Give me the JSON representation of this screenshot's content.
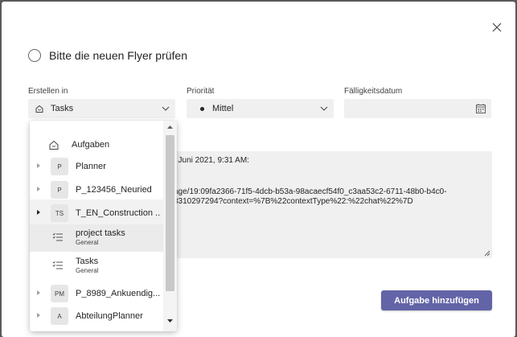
{
  "dialog": {
    "task_title": "Bitte die neuen Flyer prüfen"
  },
  "fields": {
    "create_in_label": "Erstellen in",
    "create_in_value": "Tasks",
    "priority_label": "Priorität",
    "priority_value": "Mittel",
    "due_date_label": "Fälligkeitsdatum",
    "due_date_value": ""
  },
  "notes": {
    "line1": ". Juni 2021, 9:31 AM:",
    "line2": "age/19:09fa2366-71f5-4dcb-b53a-98acaecf54f0_c3aa53c2-6711-48b0-b4c0-",
    "line3": "3310297294?context=%7B%22contextType%22:%22chat%22%7D"
  },
  "add_button": "Aufgabe hinzufügen",
  "dropdown": {
    "items": [
      {
        "label": "Aufgaben",
        "kind": "icon-home"
      },
      {
        "label": "Planner",
        "kind": "avatar",
        "avatar": "P"
      },
      {
        "label": "P_123456_Neuried",
        "kind": "avatar",
        "avatar": "P"
      },
      {
        "label": "T_EN_Construction ...",
        "kind": "avatar",
        "avatar": "TS"
      },
      {
        "label": "project tasks",
        "sub": "General",
        "kind": "icon-list"
      },
      {
        "label": "Tasks",
        "sub": "General",
        "kind": "icon-list"
      },
      {
        "label": "P_8989_Ankuendig...",
        "kind": "avatar",
        "avatar": "PM"
      },
      {
        "label": "AbteilungPlanner",
        "kind": "avatar",
        "avatar": "A"
      }
    ]
  },
  "colors": {
    "accent": "#6264a7",
    "field_bg": "#f0f0f0"
  }
}
